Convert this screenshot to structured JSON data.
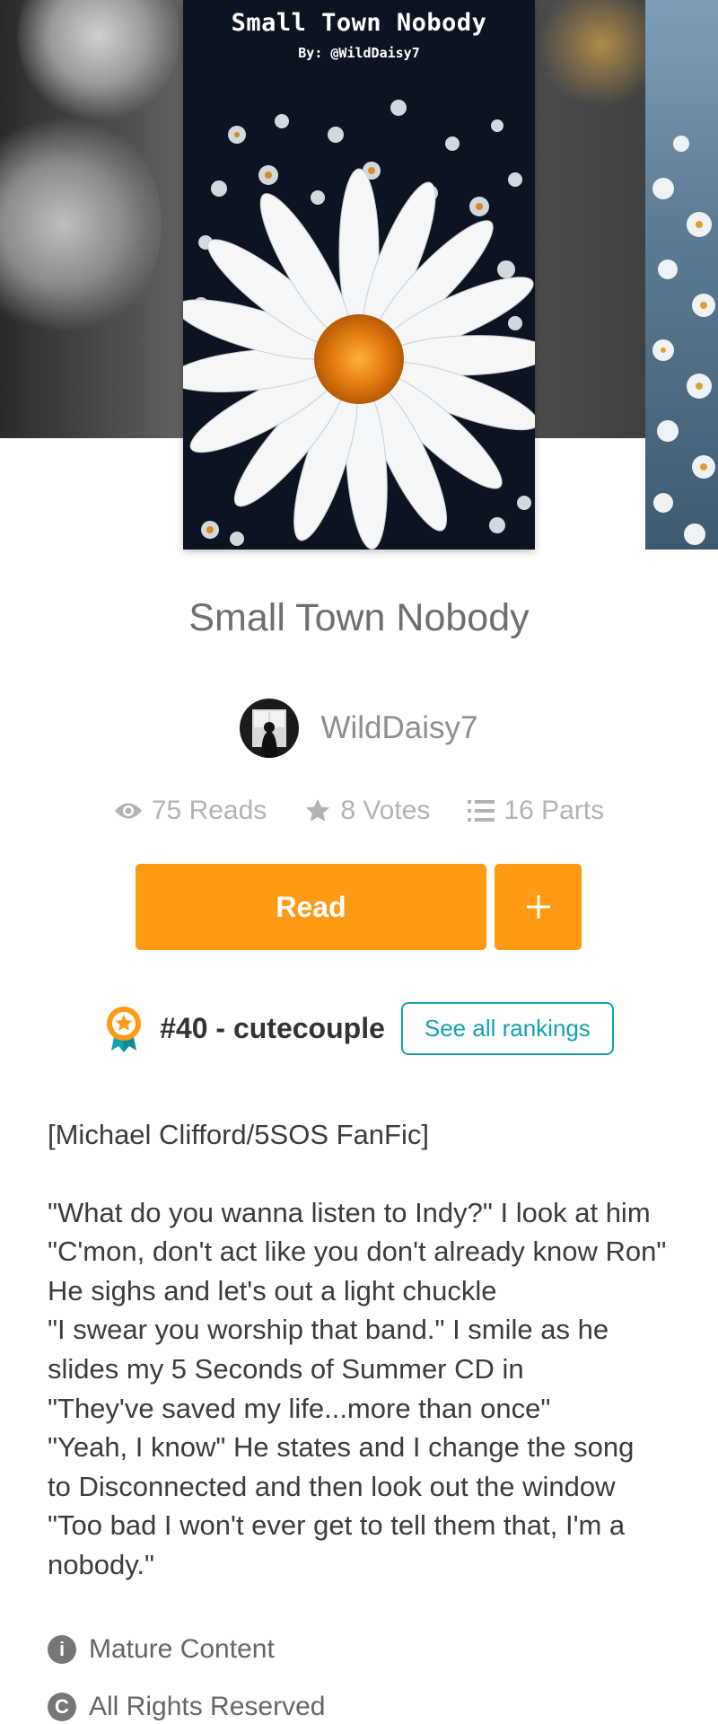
{
  "cover": {
    "title": "Small Town Nobody",
    "byline": "By: @WildDaisy7"
  },
  "story": {
    "title": "Small Town Nobody",
    "author": "WildDaisy7"
  },
  "stats": {
    "reads": "75 Reads",
    "votes": "8 Votes",
    "parts": "16 Parts"
  },
  "actions": {
    "read_label": "Read",
    "add_label": "+"
  },
  "ranking": {
    "text": "#40 - cutecouple",
    "button_label": "See all rankings"
  },
  "description": {
    "tag": "[Michael Clifford/5SOS FanFic]",
    "lines": [
      "\"What do you wanna listen to Indy?\" I look at him",
      "\"C'mon, don't act like you don't already know Ron\"",
      "He sighs and let's out a light chuckle",
      "\"I swear you worship that band.\" I smile as he",
      "slides my 5 Seconds of Summer CD in",
      "\"They've saved my life...more than once\"",
      "\"Yeah, I know\" He states and I change the song",
      "to Disconnected and then look out the window",
      "\"Too bad I won't ever get to tell them that, I'm a",
      "nobody.\""
    ]
  },
  "info": {
    "mature": "Mature Content",
    "rights": "All Rights Reserved"
  },
  "colors": {
    "accent": "#ff9a14",
    "teal": "#12a3ad"
  }
}
